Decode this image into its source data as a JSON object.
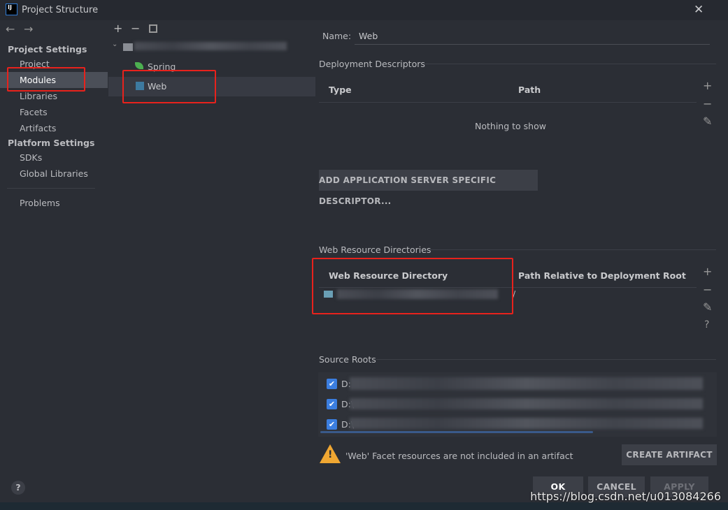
{
  "window": {
    "title": "Project Structure",
    "logo": "IJ"
  },
  "nav": {
    "back": "←",
    "forward": "→"
  },
  "sidebar": {
    "project_settings": "Project Settings",
    "items": [
      {
        "label": "Project"
      },
      {
        "label": "Modules",
        "selected": true
      },
      {
        "label": "Libraries"
      },
      {
        "label": "Facets"
      },
      {
        "label": "Artifacts"
      }
    ],
    "platform_settings": "Platform Settings",
    "platform_items": [
      {
        "label": "SDKs"
      },
      {
        "label": "Global Libraries"
      }
    ],
    "problems": "Problems",
    "help": "?"
  },
  "tree": {
    "add": "+",
    "remove": "−",
    "children": [
      {
        "label": "Spring",
        "icon": "spring-leaf-icon"
      },
      {
        "label": "Web",
        "icon": "web-facet-icon",
        "selected": true
      }
    ]
  },
  "main": {
    "name_label": "Name:",
    "name_value": "Web",
    "deployment_descriptors": "Deployment Descriptors",
    "dd_columns": [
      "Type",
      "Path"
    ],
    "dd_empty": "Nothing to show",
    "add_descriptor_button": "ADD APPLICATION SERVER SPECIFIC DESCRIPTOR...",
    "web_resource_directories": "Web Resource Directories",
    "wrd_columns": [
      "Web Resource Directory",
      "Path Relative to Deployment Root"
    ],
    "wrd_row_path": "/",
    "source_roots": "Source Roots",
    "source_roots_items": [
      {
        "prefix": "D:",
        "checked": true
      },
      {
        "prefix": "D:\\",
        "checked": true
      },
      {
        "prefix": "D:\\",
        "checked": true
      }
    ],
    "warning": "'Web' Facet resources are not included in an artifact",
    "create_artifact": "CREATE ARTIFACT"
  },
  "footer": {
    "ok": "OK",
    "cancel": "CANCEL",
    "apply": "APPLY"
  },
  "watermark": "https://blog.csdn.net/u013084266",
  "colors": {
    "accent": "#3b7ee0",
    "highlight": "#e8221c",
    "warning": "#f0a732"
  }
}
